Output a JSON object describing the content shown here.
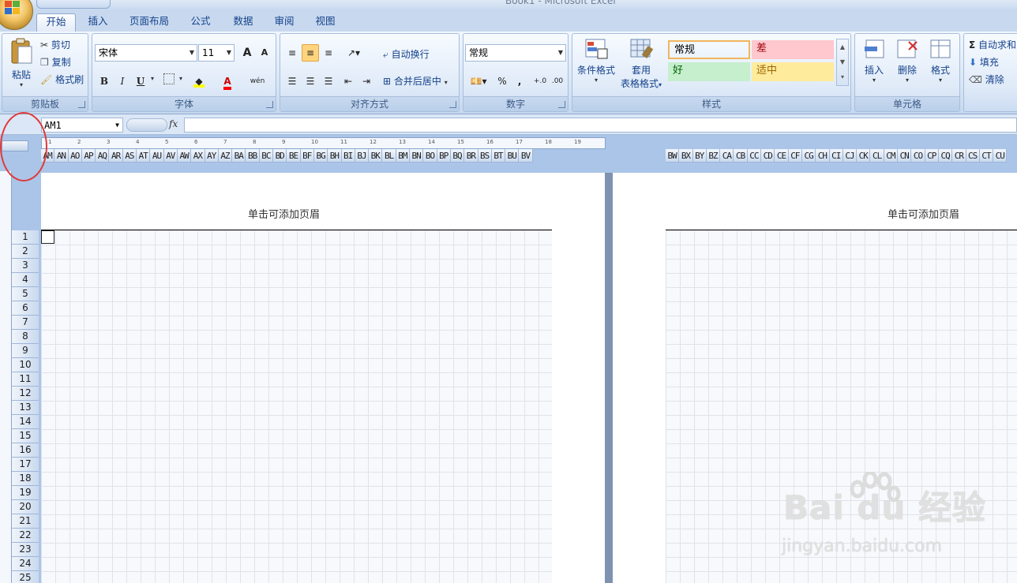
{
  "window": {
    "title": "Book1 - Microsoft Excel"
  },
  "tabs": [
    "开始",
    "插入",
    "页面布局",
    "公式",
    "数据",
    "审阅",
    "视图"
  ],
  "clipboard": {
    "paste": "粘贴",
    "cut": "剪切",
    "copy": "复制",
    "format_painter": "格式刷",
    "label": "剪贴板"
  },
  "font": {
    "name": "宋体",
    "size": "11",
    "grow": "A",
    "shrink": "A",
    "bold": "B",
    "italic": "I",
    "underline": "U",
    "color_glyph": "A",
    "phonetic": "wén",
    "label": "字体"
  },
  "alignment": {
    "wrap": "自动换行",
    "merge": "合并后居中",
    "label": "对齐方式"
  },
  "number": {
    "format": "常规",
    "percent": "%",
    "comma": ",",
    "label": "数字"
  },
  "styles": {
    "conditional": "条件格式",
    "table_top": "套用",
    "table_bottom": "表格格式",
    "cells": [
      {
        "text": "常规",
        "bg": "#ffffff"
      },
      {
        "text": "差",
        "bg": "#ffc7ce"
      },
      {
        "text": "好",
        "bg": "#c6efce"
      },
      {
        "text": "适中",
        "bg": "#ffeb9c"
      }
    ],
    "label": "样式"
  },
  "cells_group": {
    "insert": "插入",
    "delete": "删除",
    "format": "格式",
    "label": "单元格"
  },
  "editing": {
    "autosum": "自动求和",
    "fill": "填充",
    "clear": "清除"
  },
  "formula_bar": {
    "name_box": "AM1",
    "fx": "fx",
    "value": ""
  },
  "columns_left": [
    "AM",
    "AN",
    "AO",
    "AP",
    "AQ",
    "AR",
    "AS",
    "AT",
    "AU",
    "AV",
    "AW",
    "AX",
    "AY",
    "AZ",
    "BA",
    "BB",
    "BC",
    "BD",
    "BE",
    "BF",
    "BG",
    "BH",
    "BI",
    "BJ",
    "BK",
    "BL",
    "BM",
    "BN",
    "BO",
    "BP",
    "BQ",
    "BR",
    "BS",
    "BT",
    "BU",
    "BV"
  ],
  "columns_right": [
    "BW",
    "BX",
    "BY",
    "BZ",
    "CA",
    "CB",
    "CC",
    "CD",
    "CE",
    "CF",
    "CG",
    "CH",
    "CI",
    "CJ",
    "CK",
    "CL",
    "CM",
    "CN",
    "CO",
    "CP",
    "CQ",
    "CR",
    "CS",
    "CT",
    "CU"
  ],
  "rows": [
    "1",
    "2",
    "3",
    "4",
    "5",
    "6",
    "7",
    "8",
    "9",
    "10",
    "11",
    "12",
    "13",
    "14",
    "15",
    "16",
    "17",
    "18",
    "19",
    "20",
    "21",
    "22",
    "23",
    "24",
    "25"
  ],
  "page_header": "单击可添加页眉",
  "ruler_marks": [
    "1",
    "2",
    "3",
    "4",
    "5",
    "6",
    "7",
    "8",
    "9",
    "10",
    "11",
    "12",
    "13",
    "14",
    "15",
    "16",
    "17",
    "18",
    "19"
  ],
  "watermark": {
    "logo_text": "Bai du 经验",
    "url": "jingyan.baidu.com"
  }
}
